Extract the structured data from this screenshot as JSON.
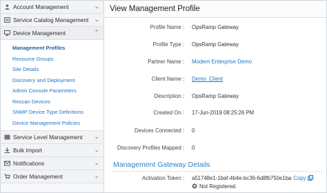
{
  "sidebar": {
    "sections_top": [
      {
        "label": "Account Management",
        "icon": "account-icon"
      },
      {
        "label": "Service Catalog Management",
        "icon": "catalog-icon"
      }
    ],
    "device_management": {
      "label": "Device Management",
      "items": [
        {
          "label": "Management Profiles",
          "active": true
        },
        {
          "label": "Resource Groups"
        },
        {
          "label": "Site Details"
        },
        {
          "label": "Discovery and Deployment"
        },
        {
          "label": "Admin Console Parameters"
        },
        {
          "label": "Rescan Devices"
        },
        {
          "label": "SNMP Device Type Definitions"
        },
        {
          "label": "Device Management Policies"
        }
      ]
    },
    "sections_bottom": [
      {
        "label": "Service Level Management",
        "icon": "service-level-icon"
      },
      {
        "label": "Bulk Import",
        "icon": "import-icon"
      },
      {
        "label": "Notifications",
        "icon": "bell-icon"
      },
      {
        "label": "Order Management",
        "icon": "cart-icon"
      }
    ]
  },
  "main": {
    "title": "View Management Profile",
    "fields": {
      "profile_name": {
        "label": "Profile Name :",
        "value": "OpsRamp Gateway"
      },
      "profile_type": {
        "label": "Profile Type :",
        "value": "OpsRamp Gateway"
      },
      "partner_name": {
        "label": "Partner Name :",
        "value": "Modern Enterprise Demo"
      },
      "client_name": {
        "label": "Client Name :",
        "value": "Demo_Client"
      },
      "description": {
        "label": "Description :",
        "value": "OpsRamp Gateway"
      },
      "created_on": {
        "label": "Created On :",
        "value": "17-Jun-2019 08:25:26 PM"
      },
      "devices_connected": {
        "label": "Devices Connected :",
        "value": "0"
      },
      "discovery_profiles": {
        "label": "Discovery Profiles Mapped :",
        "value": "0"
      }
    },
    "gateway": {
      "heading": "Management Gateway Details",
      "activation_label": "Activation Token :",
      "activation_value": "a51748e1-1baf-4b4e-bc36-6d8fb750e1ba",
      "copy_label": "Copy",
      "status": "Not Registered."
    }
  },
  "colors": {
    "link": "#1c76c9",
    "heading": "#2b84cf"
  }
}
